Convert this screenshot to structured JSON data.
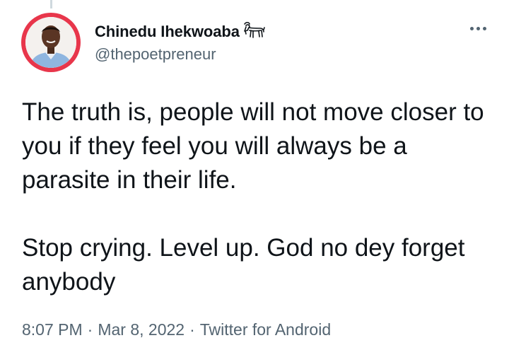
{
  "author": {
    "display_name": "Chinedu Ihekwoaba",
    "handle": "@thepoetpreneur",
    "badge_icon": "goat-icon",
    "avatar_ring_color": "#e8364b"
  },
  "tweet": {
    "paragraph_1": "The truth is, people will not move closer to you if they feel you will always be a parasite in their life.",
    "paragraph_2": "Stop crying. Level up. God no dey forget anybody"
  },
  "meta": {
    "time": "8:07 PM",
    "separator": "·",
    "date": "Mar 8, 2022",
    "source": "Twitter for Android"
  },
  "icons": {
    "more": "more-options-icon"
  },
  "colors": {
    "text_primary": "#0f1419",
    "text_secondary": "#536471"
  }
}
